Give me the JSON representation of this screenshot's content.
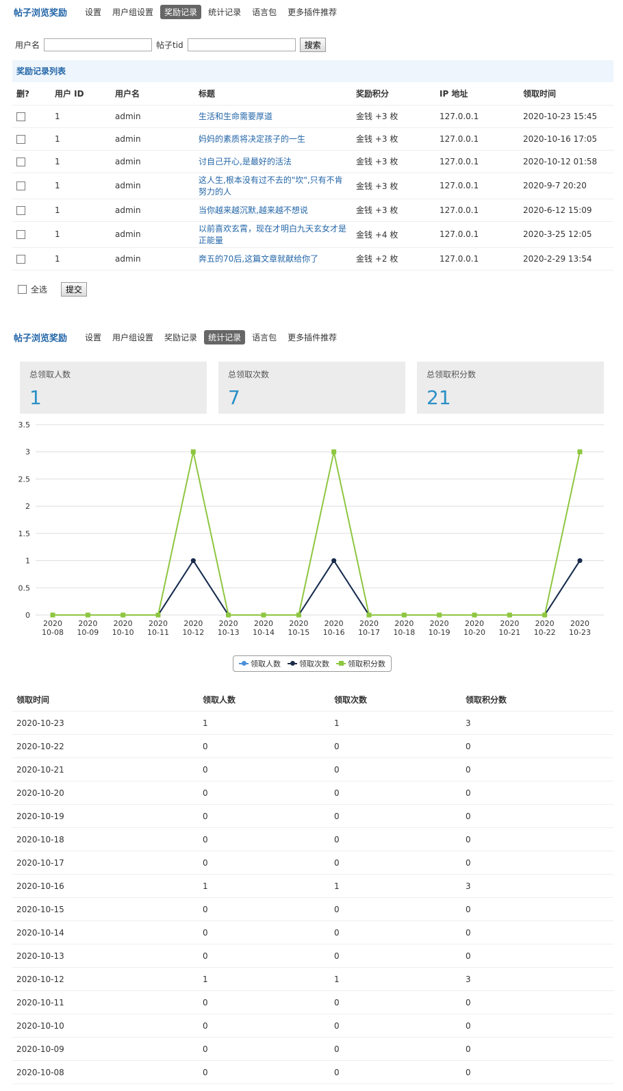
{
  "nav": {
    "brand": "帖子浏览奖励",
    "items": [
      "设置",
      "用户组设置",
      "奖励记录",
      "统计记录",
      "语言包",
      "更多插件推荐"
    ]
  },
  "search": {
    "username_label": "用户名",
    "tid_label": "帖子tid",
    "button": "搜索"
  },
  "records": {
    "title": "奖励记录列表",
    "headers": [
      "删?",
      "用户 ID",
      "用户名",
      "标题",
      "奖励积分",
      "IP 地址",
      "领取时间"
    ],
    "rows": [
      {
        "uid": "1",
        "name": "admin",
        "title": "生活和生命需要厚道",
        "reward": "金钱 +3 枚",
        "ip": "127.0.0.1",
        "time": "2020-10-23 15:45"
      },
      {
        "uid": "1",
        "name": "admin",
        "title": "妈妈的素质将决定孩子的一生",
        "reward": "金钱 +3 枚",
        "ip": "127.0.0.1",
        "time": "2020-10-16 17:05"
      },
      {
        "uid": "1",
        "name": "admin",
        "title": "讨自己开心,是最好的活法",
        "reward": "金钱 +3 枚",
        "ip": "127.0.0.1",
        "time": "2020-10-12 01:58"
      },
      {
        "uid": "1",
        "name": "admin",
        "title": "这人生,根本没有过不去的\"坎\",只有不肯努力的人",
        "reward": "金钱 +3 枚",
        "ip": "127.0.0.1",
        "time": "2020-9-7 20:20"
      },
      {
        "uid": "1",
        "name": "admin",
        "title": "当你越来越沉默,越来越不想说",
        "reward": "金钱 +3 枚",
        "ip": "127.0.0.1",
        "time": "2020-6-12 15:09"
      },
      {
        "uid": "1",
        "name": "admin",
        "title": "以前喜欢玄霄，现在才明白九天玄女才是正能量",
        "reward": "金钱 +4 枚",
        "ip": "127.0.0.1",
        "time": "2020-3-25 12:05"
      },
      {
        "uid": "1",
        "name": "admin",
        "title": "奔五的70后,这篇文章就献给你了",
        "reward": "金钱 +2 枚",
        "ip": "127.0.0.1",
        "time": "2020-2-29 13:54"
      }
    ],
    "select_all": "全选",
    "submit": "提交"
  },
  "stats": {
    "boxes": [
      {
        "label": "总领取人数",
        "value": "1"
      },
      {
        "label": "总领取次数",
        "value": "7"
      },
      {
        "label": "总领取积分数",
        "value": "21"
      }
    ]
  },
  "chart_data": {
    "type": "line",
    "x": [
      "2020\n10-08",
      "2020\n10-09",
      "2020\n10-10",
      "2020\n10-11",
      "2020\n10-12",
      "2020\n10-13",
      "2020\n10-14",
      "2020\n10-15",
      "2020\n10-16",
      "2020\n10-17",
      "2020\n10-18",
      "2020\n10-19",
      "2020\n10-20",
      "2020\n10-21",
      "2020\n10-22",
      "2020\n10-23"
    ],
    "ylim": [
      0,
      3.5
    ],
    "yticks": [
      "0",
      "0.5",
      "1",
      "1.5",
      "2",
      "2.5",
      "3",
      "3.5"
    ],
    "series": [
      {
        "name": "领取人数",
        "color": "#4a90d9",
        "values": [
          0,
          0,
          0,
          0,
          1,
          0,
          0,
          0,
          1,
          0,
          0,
          0,
          0,
          0,
          0,
          1
        ]
      },
      {
        "name": "领取次数",
        "color": "#1a2b4a",
        "values": [
          0,
          0,
          0,
          0,
          1,
          0,
          0,
          0,
          1,
          0,
          0,
          0,
          0,
          0,
          0,
          1
        ]
      },
      {
        "name": "领取积分数",
        "color": "#8dc63f",
        "values": [
          0,
          0,
          0,
          0,
          3,
          0,
          0,
          0,
          3,
          0,
          0,
          0,
          0,
          0,
          0,
          3
        ]
      }
    ],
    "legend_position": "bottom",
    "grid": true
  },
  "stat_table": {
    "headers": [
      "领取时间",
      "领取人数",
      "领取次数",
      "领取积分数"
    ],
    "rows": [
      [
        "2020-10-23",
        "1",
        "1",
        "3"
      ],
      [
        "2020-10-22",
        "0",
        "0",
        "0"
      ],
      [
        "2020-10-21",
        "0",
        "0",
        "0"
      ],
      [
        "2020-10-20",
        "0",
        "0",
        "0"
      ],
      [
        "2020-10-19",
        "0",
        "0",
        "0"
      ],
      [
        "2020-10-18",
        "0",
        "0",
        "0"
      ],
      [
        "2020-10-17",
        "0",
        "0",
        "0"
      ],
      [
        "2020-10-16",
        "1",
        "1",
        "3"
      ],
      [
        "2020-10-15",
        "0",
        "0",
        "0"
      ],
      [
        "2020-10-14",
        "0",
        "0",
        "0"
      ],
      [
        "2020-10-13",
        "0",
        "0",
        "0"
      ],
      [
        "2020-10-12",
        "1",
        "1",
        "3"
      ],
      [
        "2020-10-11",
        "0",
        "0",
        "0"
      ],
      [
        "2020-10-10",
        "0",
        "0",
        "0"
      ],
      [
        "2020-10-09",
        "0",
        "0",
        "0"
      ],
      [
        "2020-10-08",
        "0",
        "0",
        "0"
      ]
    ]
  }
}
